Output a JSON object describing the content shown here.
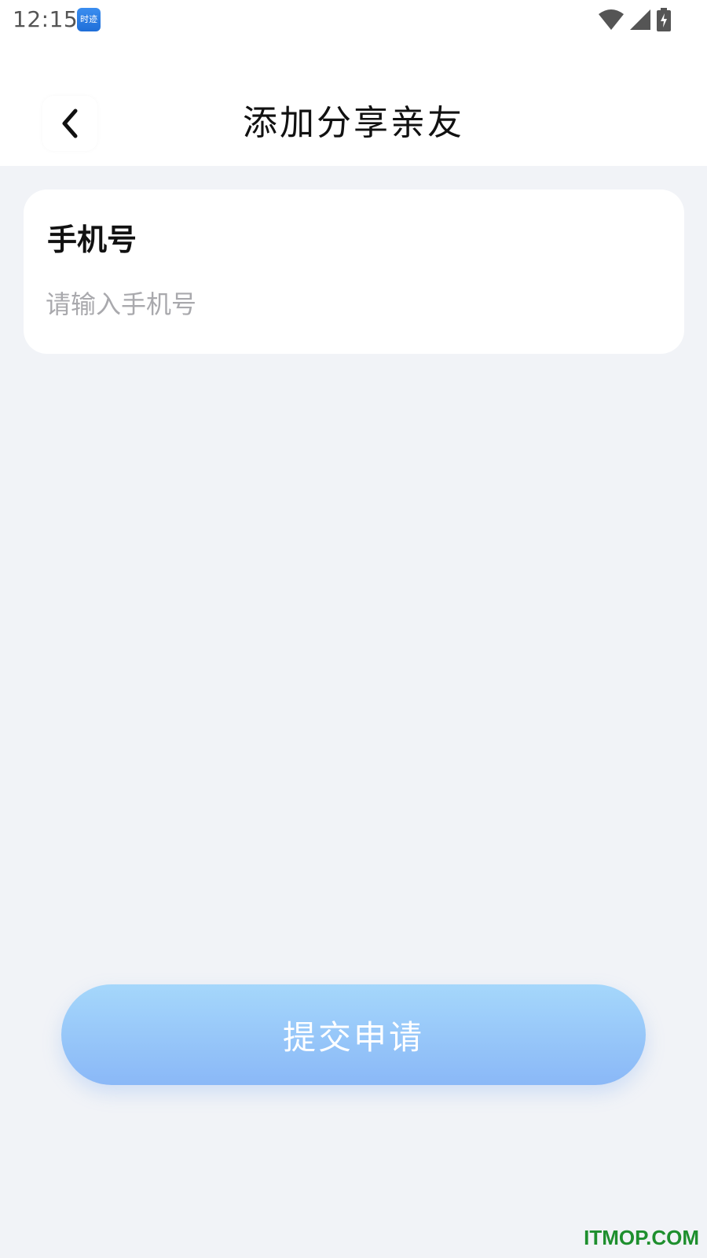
{
  "status_bar": {
    "time": "12:15",
    "app_badge_text": "时迹",
    "icons": [
      "wifi-icon",
      "signal-icon",
      "battery-charging-icon"
    ]
  },
  "header": {
    "title": "添加分享亲友",
    "back_icon": "chevron-left-icon"
  },
  "form": {
    "phone_label": "手机号",
    "phone_value": "",
    "phone_placeholder": "请输入手机号"
  },
  "actions": {
    "submit_label": "提交申请"
  },
  "watermark": {
    "text": "ITMOP.COM"
  },
  "colors": {
    "background": "#f1f3f7",
    "button_gradient_top": "#a5d7fb",
    "button_gradient_bottom": "#8ab8f7",
    "watermark": "#1e8f2e"
  }
}
